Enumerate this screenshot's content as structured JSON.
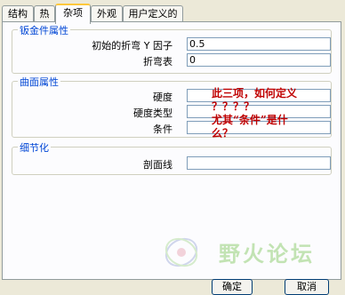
{
  "tabs": [
    "结构",
    "热",
    "杂项",
    "外观",
    "用户定义的"
  ],
  "active_tab": "杂项",
  "sheet_metal": {
    "title": "钣金件属性",
    "initial_bend_label": "初始的折弯 Y 因子",
    "initial_bend_value": "0.5",
    "bend_table_label": "折弯表",
    "bend_table_value": "0"
  },
  "surface": {
    "title": "曲面属性",
    "hardness_label": "硬度",
    "hardness_type_label": "硬度类型",
    "condition_label": "条件"
  },
  "detail": {
    "title": "细节化",
    "section_line_label": "剖面线"
  },
  "annotation": {
    "line1": "此三项，如何定义",
    "line2": "？？？？",
    "line3": "尤其“条件”是什",
    "line4": "么？",
    "color": "#c00000"
  },
  "watermark": {
    "text": "野火论坛"
  },
  "buttons": {
    "ok": "确定",
    "cancel": "取消"
  }
}
